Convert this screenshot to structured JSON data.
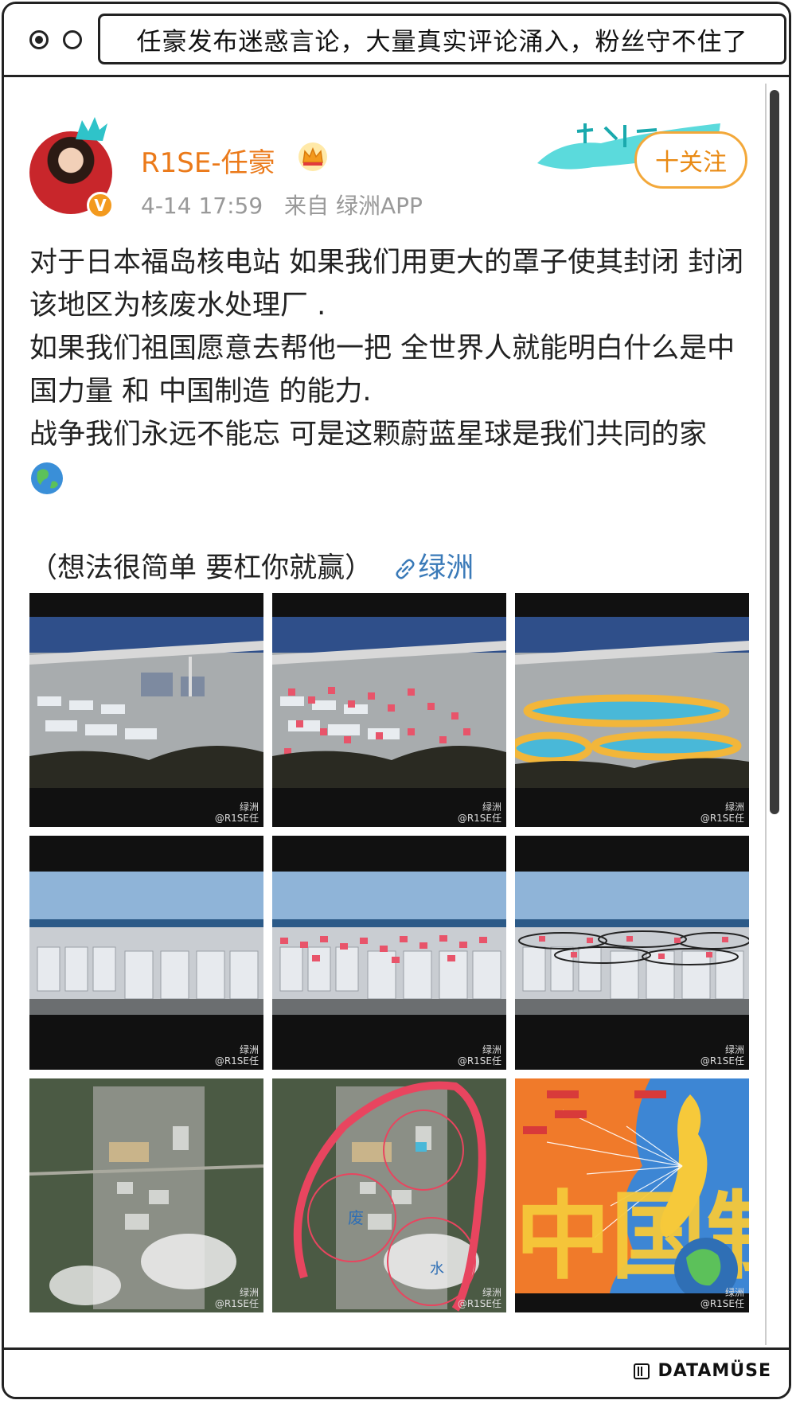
{
  "window": {
    "title": "任豪发布迷惑言论，大量真实评论涌入，粉丝守不住了"
  },
  "post": {
    "username": "R1SE-任豪",
    "time": "4-14 17:59",
    "source": "来自 绿洲APP",
    "follow_label": "十关注",
    "text_lines": [
      "对于日本福岛核电站 如果我们用更大的罩子使其封闭 封闭该地区为核废水处理厂 .",
      "如果我们祖国愿意去帮他一把 全世界人就能明白什么是中国力量 和 中国制造 的能力.",
      "战争我们永远不能忘 可是这颗蔚蓝星球是我们共同的家"
    ],
    "tail_text": "（想法很简单 要杠你就赢）",
    "link_label": "绿洲",
    "watermark_line1": "绿洲",
    "watermark_line2": "@R1SE任",
    "map_labels": {
      "waste": "废",
      "water": "水"
    },
    "big_chars": "中国制"
  },
  "footer": {
    "brand": "DATAMÜSE"
  },
  "colors": {
    "accent_orange": "#eb7a1a",
    "link_blue": "#3a7ab8",
    "follow_border": "#f3a83a"
  }
}
